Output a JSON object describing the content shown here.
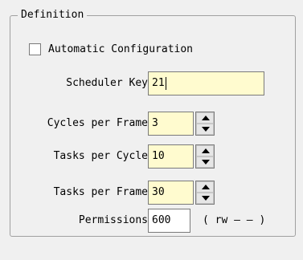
{
  "group": {
    "title": "Definition"
  },
  "auto_config": {
    "label": "Automatic Configuration",
    "checked": false
  },
  "scheduler_key": {
    "label": "Scheduler Key",
    "value": "21"
  },
  "cycles_per_frame": {
    "label": "Cycles per Frame",
    "value": "3"
  },
  "tasks_per_cycle": {
    "label": "Tasks per Cycle",
    "value": "10"
  },
  "tasks_per_frame": {
    "label": "Tasks per Frame",
    "value": "30"
  },
  "permissions": {
    "label": "Permissions",
    "value": "600",
    "mode_text": "( rw — — )"
  },
  "colors": {
    "field_bg": "#fffbcf",
    "window_bg": "#f0f0f0",
    "border": "#a0a0a0"
  },
  "icons": {
    "spin_up": "triangle-up-icon",
    "spin_down": "triangle-down-icon"
  }
}
